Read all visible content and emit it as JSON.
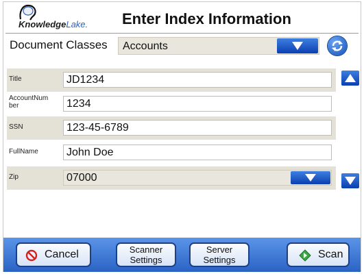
{
  "header": {
    "logo_text_main": "Knowledge",
    "logo_text_accent": "Lake",
    "logo_text_suffix": ".",
    "title": "Enter Index Information"
  },
  "document_classes": {
    "label": "Document Classes",
    "selected": "Accounts"
  },
  "fields": [
    {
      "label": "Title",
      "value": "JD1234"
    },
    {
      "label": "AccountNumber",
      "value": "1234"
    },
    {
      "label": "SSN",
      "value": "123-45-6789"
    },
    {
      "label": "FullName",
      "value": "John Doe"
    },
    {
      "label": "Zip",
      "value": "07000"
    }
  ],
  "footer": {
    "cancel": "Cancel",
    "scanner_settings_line1": "Scanner",
    "scanner_settings_line2": "Settings",
    "server_settings_line1": "Server",
    "server_settings_line2": "Settings",
    "scan": "Scan"
  },
  "colors": {
    "accent_blue": "#1c55c8",
    "footer_blue": "#3c78d8",
    "row_shade": "#e4e1d7"
  }
}
